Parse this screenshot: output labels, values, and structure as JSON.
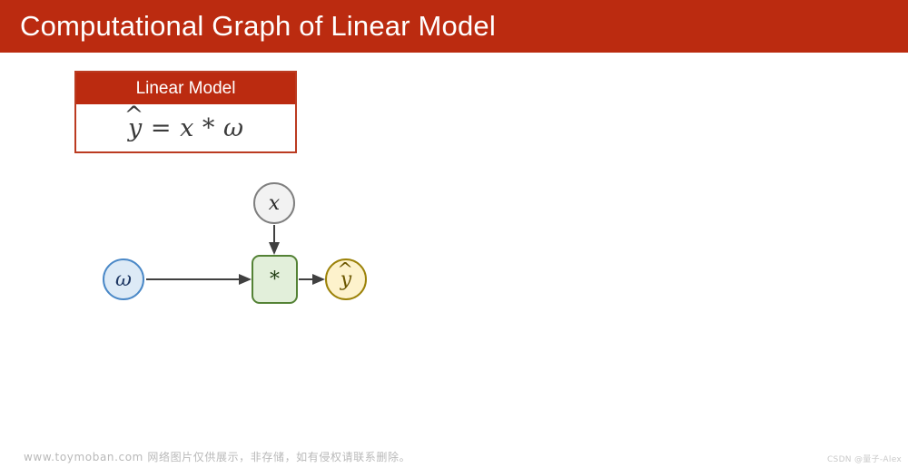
{
  "slide": {
    "title": "Computational Graph of Linear Model",
    "header_color": "#bb2b10",
    "background_color": "#ffffff"
  },
  "linear_model_card": {
    "header_label": "Linear Model",
    "formula": {
      "lhs_base": "y",
      "lhs_hat": "^",
      "equals": "=",
      "operand_1": "x",
      "operator": "*",
      "operand_2": "ω",
      "plain_text": "ŷ = x * ω"
    },
    "border_color": "#bb3b21",
    "header_background": "#bb2b10"
  },
  "graph": {
    "title": "computational graph",
    "nodes": [
      {
        "id": "x",
        "label": "x",
        "shape": "circle",
        "fill": "#f2f2f2",
        "stroke": "#7f7f7f"
      },
      {
        "id": "omega",
        "label": "ω",
        "shape": "circle",
        "fill": "#ddeaf6",
        "stroke": "#4a88c7"
      },
      {
        "id": "multiply",
        "label": "*",
        "shape": "rounded-square",
        "fill": "#e2efda",
        "stroke": "#548235"
      },
      {
        "id": "yhat",
        "label_base": "y",
        "label_hat": "^",
        "label": "ŷ",
        "shape": "circle",
        "fill": "#fdf2cc",
        "stroke": "#9c8208"
      }
    ],
    "edges": [
      {
        "from": "x",
        "to": "multiply",
        "direction": "down"
      },
      {
        "from": "omega",
        "to": "multiply",
        "direction": "right"
      },
      {
        "from": "multiply",
        "to": "yhat",
        "direction": "right"
      }
    ],
    "edge_color": "#404040"
  },
  "footer": {
    "note": "www.toymoban.com 网络图片仅供展示，非存储，如有侵权请联系删除。",
    "watermark": "CSDN @量子-Alex"
  }
}
